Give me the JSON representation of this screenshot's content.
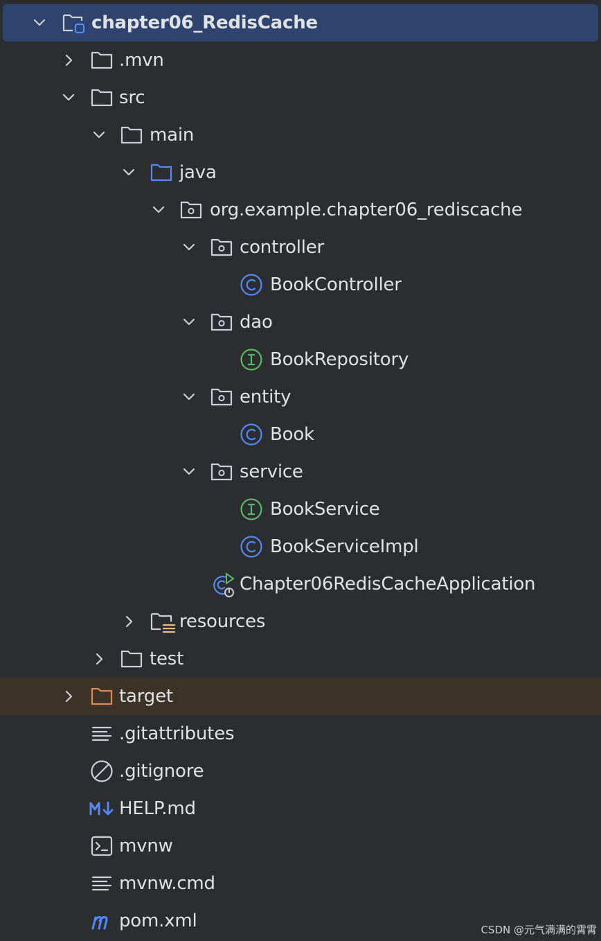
{
  "project_tree": {
    "root": {
      "label": "chapter06_RedisCache",
      "icon": "project-module-icon",
      "expanded": true
    },
    "items": [
      {
        "label": ".mvn",
        "icon": "folder-icon",
        "expanded": false
      },
      {
        "label": "src",
        "icon": "folder-icon",
        "expanded": true
      },
      {
        "label": "main",
        "icon": "folder-icon",
        "expanded": true
      },
      {
        "label": "java",
        "icon": "source-root-folder-icon",
        "expanded": true
      },
      {
        "label": "org.example.chapter06_rediscache",
        "icon": "package-icon",
        "expanded": true
      },
      {
        "label": "controller",
        "icon": "package-icon",
        "expanded": true
      },
      {
        "label": "BookController",
        "icon": "class-icon"
      },
      {
        "label": "dao",
        "icon": "package-icon",
        "expanded": true
      },
      {
        "label": "BookRepository",
        "icon": "interface-icon"
      },
      {
        "label": "entity",
        "icon": "package-icon",
        "expanded": true
      },
      {
        "label": "Book",
        "icon": "class-icon"
      },
      {
        "label": "service",
        "icon": "package-icon",
        "expanded": true
      },
      {
        "label": "BookService",
        "icon": "interface-icon"
      },
      {
        "label": "BookServiceImpl",
        "icon": "class-icon"
      },
      {
        "label": "Chapter06RedisCacheApplication",
        "icon": "spring-boot-application-icon"
      },
      {
        "label": "resources",
        "icon": "resources-folder-icon",
        "expanded": false
      },
      {
        "label": "test",
        "icon": "folder-icon",
        "expanded": false
      },
      {
        "label": "target",
        "icon": "excluded-folder-icon",
        "expanded": false
      },
      {
        "label": ".gitattributes",
        "icon": "text-file-icon"
      },
      {
        "label": ".gitignore",
        "icon": "ignore-file-icon"
      },
      {
        "label": "HELP.md",
        "icon": "markdown-file-icon"
      },
      {
        "label": "mvnw",
        "icon": "shell-script-icon"
      },
      {
        "label": "mvnw.cmd",
        "icon": "text-file-icon"
      },
      {
        "label": "pom.xml",
        "icon": "maven-pom-icon"
      }
    ]
  },
  "watermark": "CSDN @元气满满的霄霄",
  "colors": {
    "background": "#2b2d30",
    "selection": "#2e436e",
    "excluded_row": "#3c3226",
    "text": "#dfe1e5",
    "folder_outline": "#ced0d6",
    "source_root": "#548af7",
    "class_icon": "#548af7",
    "interface_icon": "#5fb865",
    "excluded_folder": "#e08855",
    "markdown": "#548af7"
  }
}
